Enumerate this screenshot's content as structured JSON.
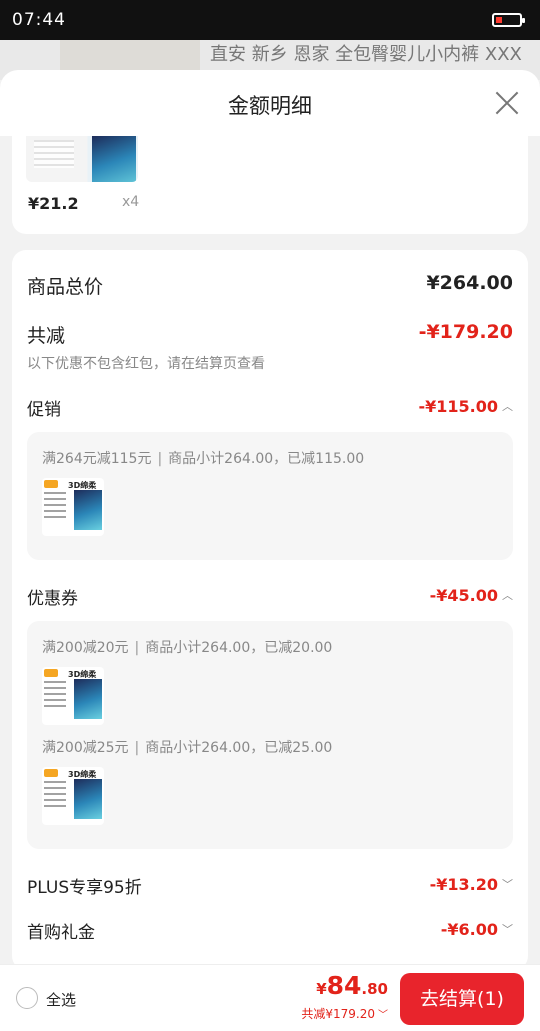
{
  "status_bar": {
    "time": "07:44"
  },
  "background_page": {
    "product_title": "直安 新乡 恩家 全包臀婴儿小内裤 XXX"
  },
  "sheet": {
    "title": "金额明细"
  },
  "product": {
    "price": "¥21.2",
    "quantity": "x4"
  },
  "summary": {
    "total_label": "商品总价",
    "total_value": "¥264.00",
    "discount_label": "共减",
    "discount_value": "-¥179.20",
    "note": "以下优惠不包含红包，请在结算页查看"
  },
  "promotion": {
    "label": "促销",
    "value": "-¥115.00",
    "rules": [
      {
        "condition": "满264元减115元",
        "detail": "商品小计264.00，已减115.00"
      }
    ]
  },
  "coupon": {
    "label": "优惠券",
    "value": "-¥45.00",
    "rules": [
      {
        "condition": "满200减20元",
        "detail": "商品小计264.00，已减20.00"
      },
      {
        "condition": "满200减25元",
        "detail": "商品小计264.00，已减25.00"
      }
    ]
  },
  "plus": {
    "label": "PLUS专享95折",
    "value": "-¥13.20"
  },
  "first_purchase": {
    "label": "首购礼金",
    "value": "-¥6.00"
  },
  "thumbnail_text": "3D绵柔",
  "bottom_bar": {
    "select_all": "全选",
    "currency": "¥",
    "price_int": "84",
    "price_dec": ".80",
    "saved": "共减¥179.20",
    "checkout": "去结算(1)"
  },
  "colors": {
    "accent": "#e8242c",
    "discount": "#e2231a"
  },
  "icons": {
    "close": "close-icon",
    "chevron_up": "chevron-up-icon",
    "chevron_down": "chevron-down-icon",
    "radio": "radio-unchecked-icon"
  }
}
